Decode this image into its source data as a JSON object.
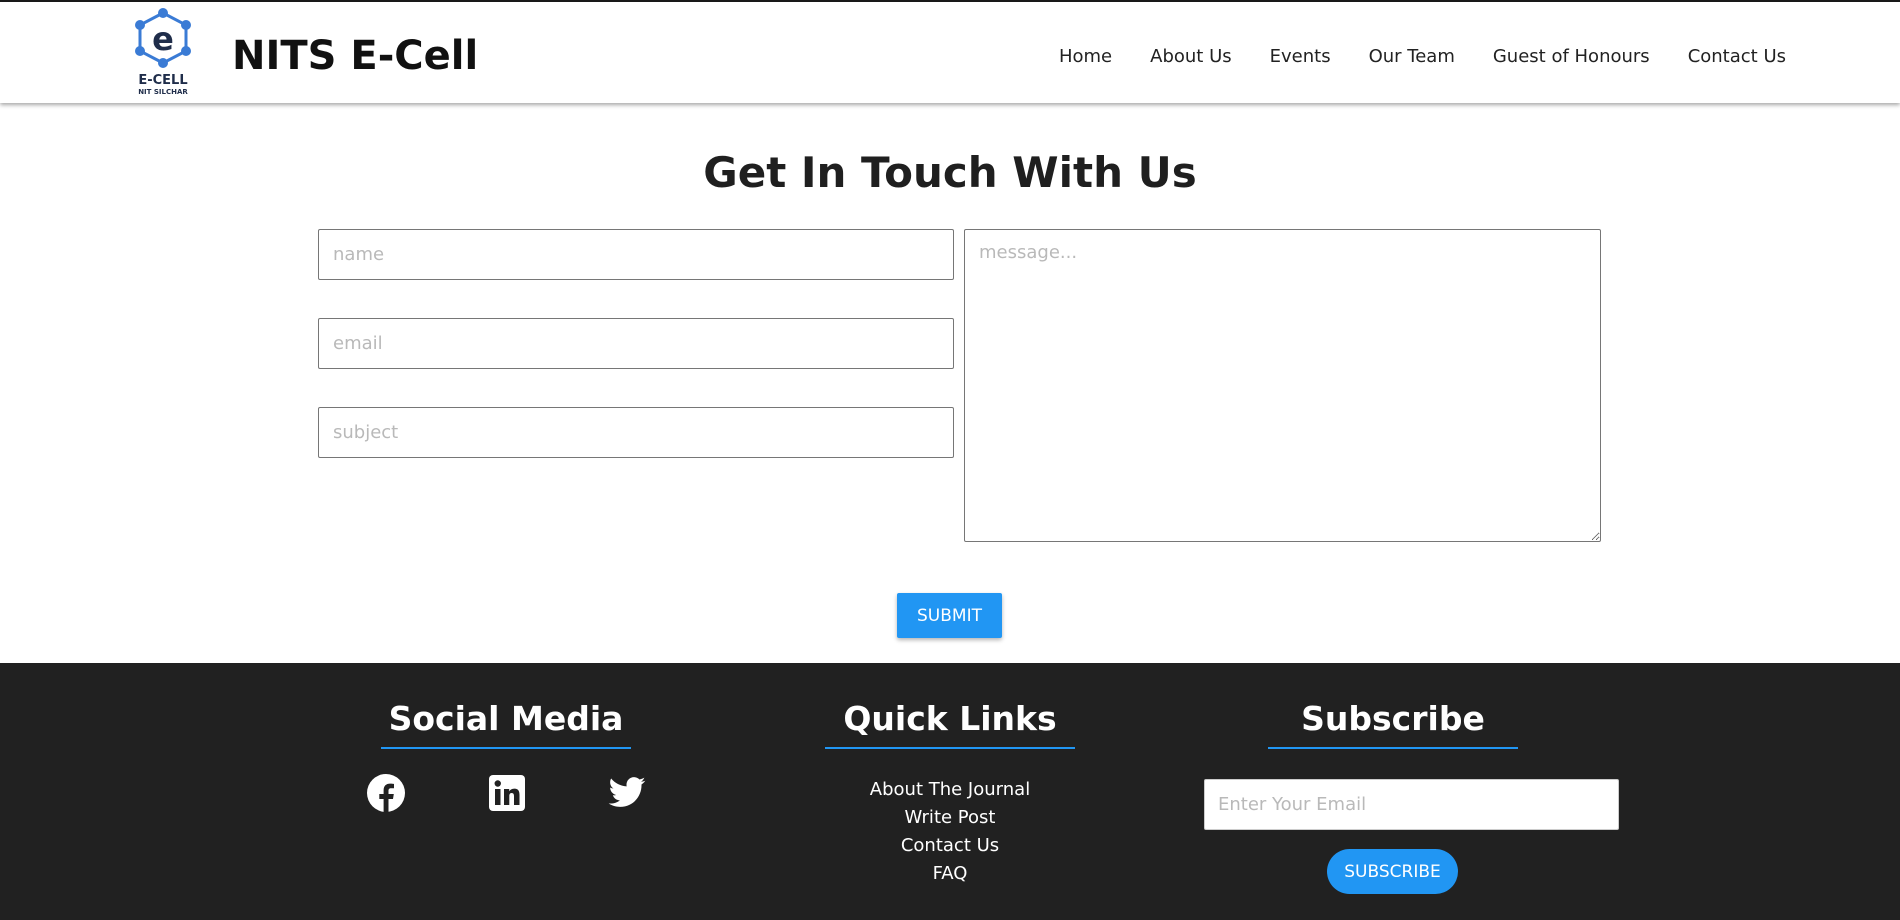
{
  "header": {
    "logo": {
      "text_main": "E-CELL",
      "text_sub": "NIT SILCHAR",
      "icon": "hexagon-e-logo-icon",
      "color": "#3a7bd5"
    },
    "brand": "NITS E-Cell",
    "nav": [
      "Home",
      "About Us",
      "Events",
      "Our Team",
      "Guest of Honours",
      "Contact Us"
    ]
  },
  "contact": {
    "title": "Get In Touch With Us",
    "name_placeholder": "name",
    "email_placeholder": "email",
    "subject_placeholder": "subject",
    "message_placeholder": "message...",
    "submit_label": "SUBMIT"
  },
  "footer": {
    "social": {
      "title": "Social Media",
      "icons": [
        "facebook-icon",
        "linkedin-icon",
        "twitter-icon"
      ]
    },
    "quick_links": {
      "title": "Quick Links",
      "items": [
        "About The Journal",
        "Write Post",
        "Contact Us",
        "FAQ"
      ]
    },
    "subscribe": {
      "title": "Subscribe",
      "email_placeholder": "Enter Your Email",
      "button_label": "SUBSCRIBE"
    }
  },
  "colors": {
    "accent": "#2196f3",
    "footer_bg": "#212121",
    "text_dark": "#1f1f1f"
  }
}
